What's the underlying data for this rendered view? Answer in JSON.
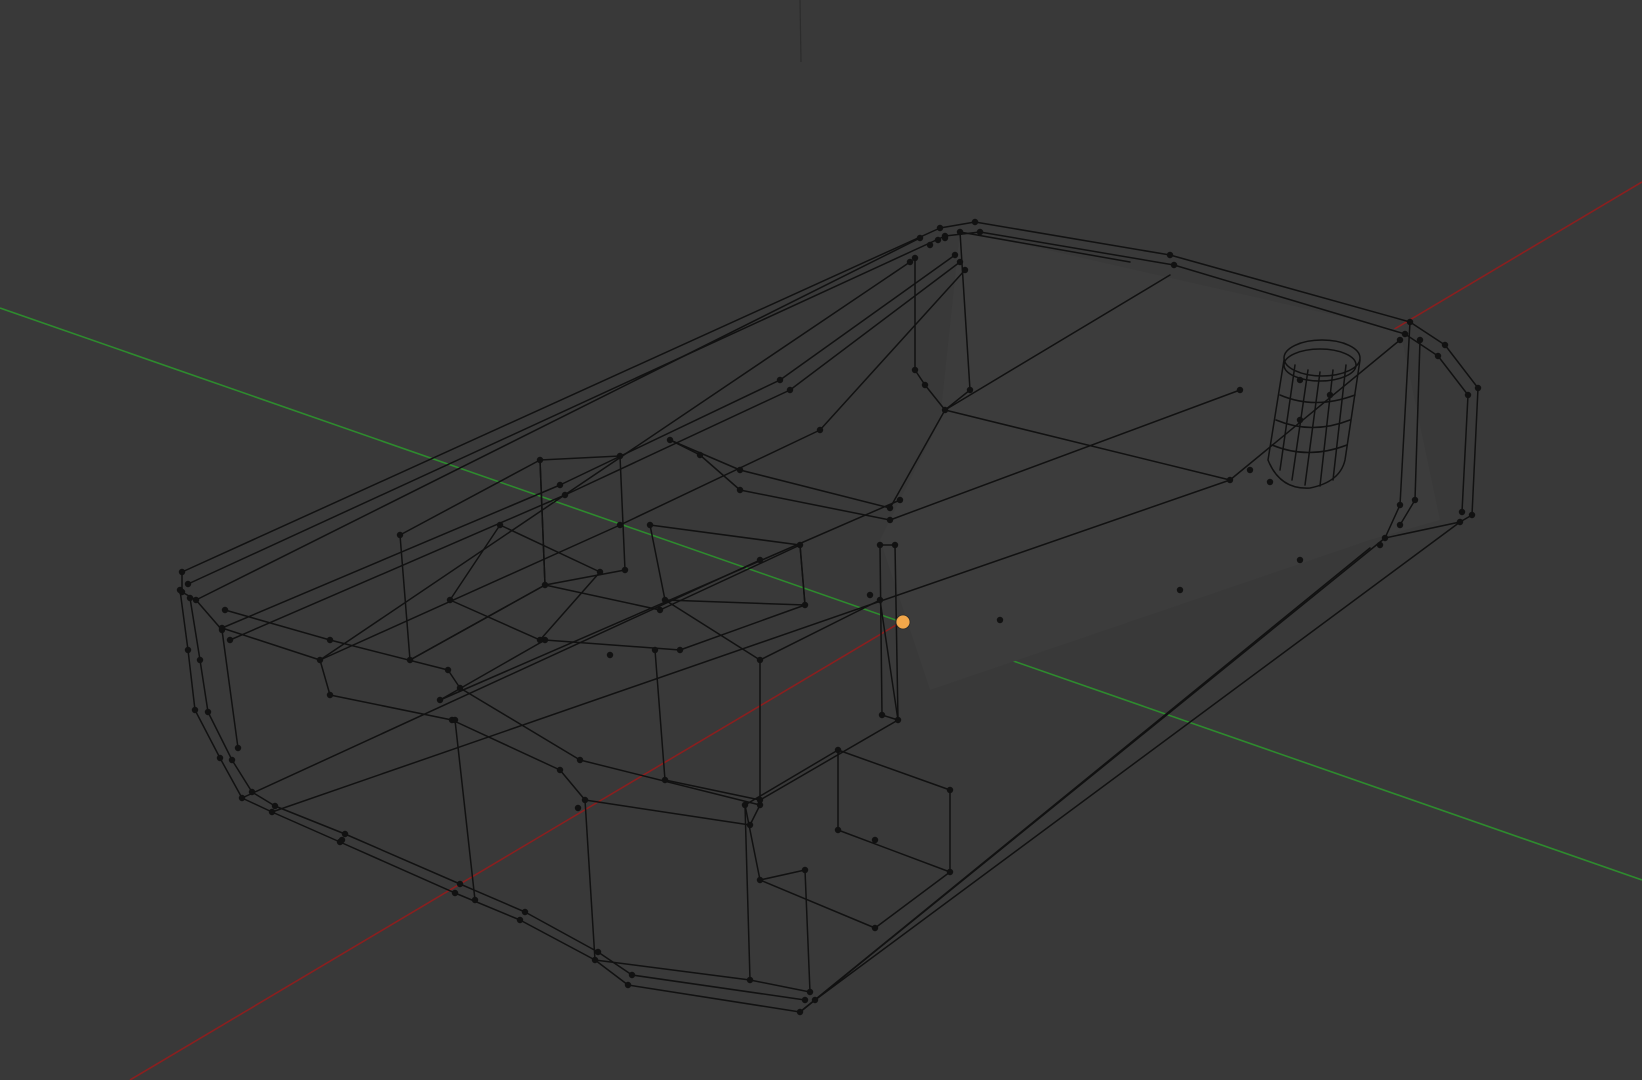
{
  "viewport": {
    "mode": "wireframe",
    "editor": "3d-view",
    "colors": {
      "background": "#393939",
      "x_axis": "#8a1f1f",
      "y_axis": "#2e8b2e",
      "wire": "#111111",
      "vertex": "#111111",
      "object_origin": "#f2a74a"
    }
  },
  "object": {
    "type": "mesh",
    "display": "wireframe-with-vertices",
    "origin_marker": true
  }
}
